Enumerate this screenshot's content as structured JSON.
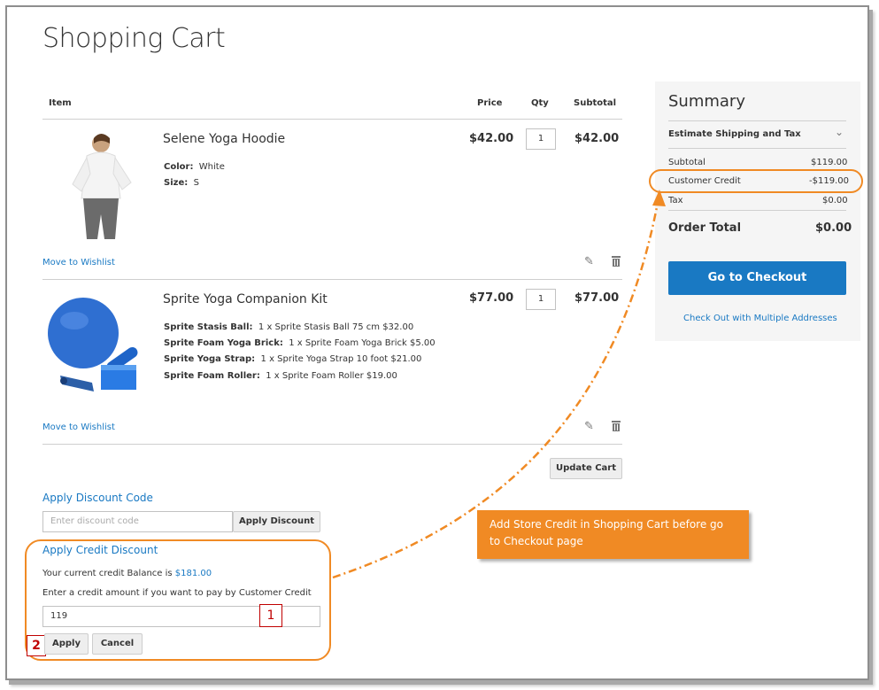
{
  "page": {
    "title": "Shopping Cart"
  },
  "table": {
    "headers": {
      "item": "Item",
      "price": "Price",
      "qty": "Qty",
      "subtotal": "Subtotal"
    }
  },
  "items": [
    {
      "name": "Selene Yoga Hoodie",
      "options": [
        {
          "label": "Color:",
          "value": "White"
        },
        {
          "label": "Size:",
          "value": "S"
        }
      ],
      "price": "$42.00",
      "qty": "1",
      "subtotal": "$42.00",
      "wishlist": "Move to Wishlist"
    },
    {
      "name": "Sprite Yoga Companion Kit",
      "options": [
        {
          "label": "Sprite Stasis Ball:",
          "value": "1 x Sprite Stasis Ball 75 cm $32.00"
        },
        {
          "label": "Sprite Foam Yoga Brick:",
          "value": "1 x Sprite Foam Yoga Brick $5.00"
        },
        {
          "label": "Sprite Yoga Strap:",
          "value": "1 x Sprite Yoga Strap 10 foot $21.00"
        },
        {
          "label": "Sprite Foam Roller:",
          "value": "1 x Sprite Foam Roller $19.00"
        }
      ],
      "price": "$77.00",
      "qty": "1",
      "subtotal": "$77.00",
      "wishlist": "Move to Wishlist"
    }
  ],
  "update_cart": "Update Cart",
  "discount": {
    "title": "Apply Discount Code",
    "placeholder": "Enter discount code",
    "button": "Apply Discount"
  },
  "credit": {
    "title": "Apply Credit Discount",
    "balance_text": "Your current credit Balance is ",
    "balance_value": "$181.00",
    "enter_text": "Enter a credit amount if you want to pay by Customer Credit",
    "amount": "119",
    "apply": "Apply",
    "cancel": "Cancel"
  },
  "summary": {
    "title": "Summary",
    "estimate": "Estimate Shipping and Tax",
    "rows": [
      {
        "label": "Subtotal",
        "value": "$119.00"
      },
      {
        "label": "Customer Credit",
        "value": "-$119.00"
      },
      {
        "label": "Tax",
        "value": "$0.00"
      }
    ],
    "order_total_label": "Order Total",
    "order_total_value": "$0.00",
    "checkout": "Go to Checkout",
    "multiple": "Check Out with Multiple Addresses"
  },
  "callout": {
    "text": "Add Store Credit in Shopping Cart before go to Checkout page"
  },
  "markers": {
    "one": "1",
    "two": "2"
  },
  "colors": {
    "accent": "#1979c3",
    "annotation": "#f08a24",
    "marker": "#c00000"
  }
}
